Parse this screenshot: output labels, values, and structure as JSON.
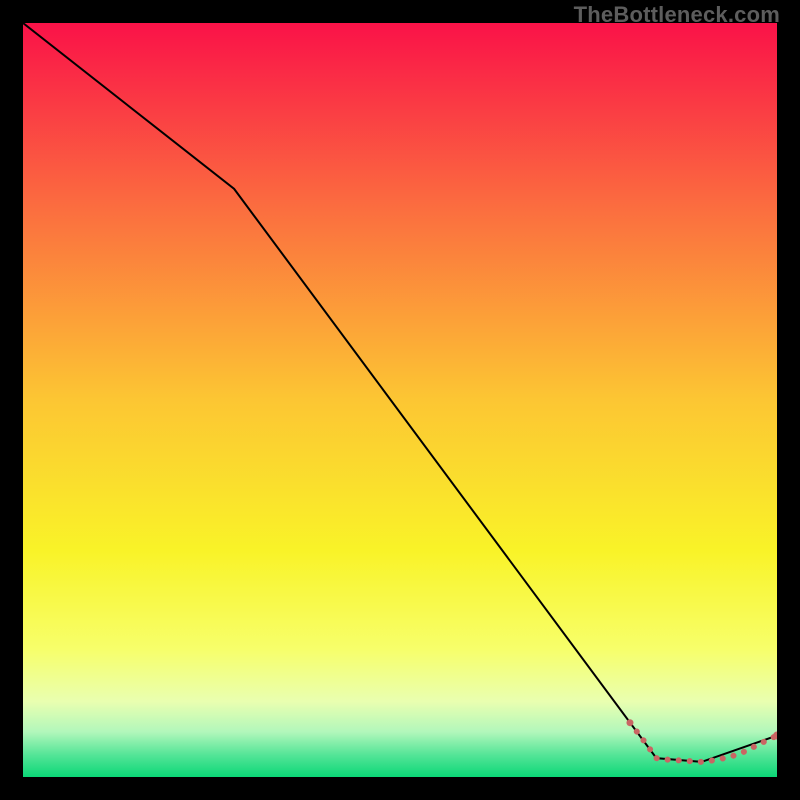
{
  "watermark": "TheBottleneck.com",
  "chart_data": {
    "type": "line",
    "title": "",
    "xlabel": "",
    "ylabel": "",
    "xlim": [
      0,
      100
    ],
    "ylim": [
      0,
      100
    ],
    "grid": false,
    "legend": false,
    "series": [
      {
        "name": "main-curve",
        "color": "#000000",
        "style": "solid",
        "points": false,
        "x": [
          0,
          28,
          84,
          90,
          100
        ],
        "y": [
          100,
          78,
          2.5,
          2.0,
          5.5
        ]
      },
      {
        "name": "dotted-highlight",
        "color": "#c96563",
        "style": "dotted",
        "points": true,
        "x": [
          80.5,
          82.5,
          84,
          85.5,
          87,
          88.5,
          90,
          91.5,
          93,
          94.5,
          96,
          97.5,
          100
        ],
        "y": [
          7.2,
          4.6,
          2.5,
          2.3,
          2.2,
          2.1,
          2.0,
          2.2,
          2.5,
          2.9,
          3.5,
          4.3,
          5.5
        ]
      }
    ],
    "background_gradient": {
      "type": "vertical",
      "stops": [
        {
          "offset": 0.0,
          "color": "#fa1248"
        },
        {
          "offset": 0.25,
          "color": "#fb6f3f"
        },
        {
          "offset": 0.5,
          "color": "#fcc633"
        },
        {
          "offset": 0.7,
          "color": "#f9f328"
        },
        {
          "offset": 0.83,
          "color": "#f7ff6a"
        },
        {
          "offset": 0.9,
          "color": "#e9ffb0"
        },
        {
          "offset": 0.94,
          "color": "#b2f7bb"
        },
        {
          "offset": 0.97,
          "color": "#56e598"
        },
        {
          "offset": 1.0,
          "color": "#0bd777"
        }
      ]
    }
  }
}
